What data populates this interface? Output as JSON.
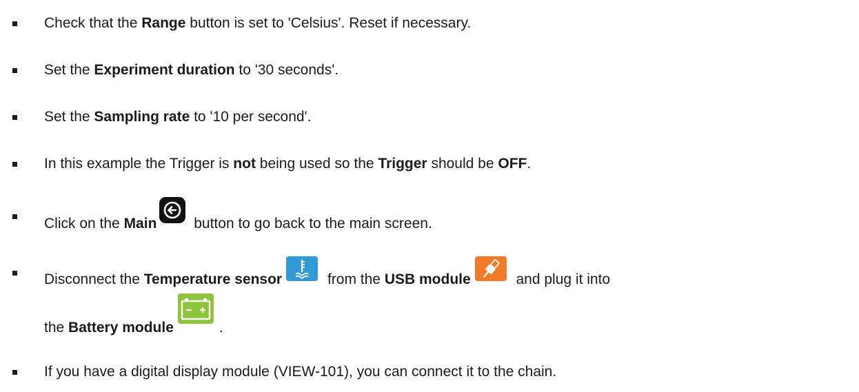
{
  "items": [
    {
      "parts": [
        "Check that the ",
        "Range",
        " button is set to 'Celsius'. Reset if necessary."
      ]
    },
    {
      "parts": [
        "Set the ",
        "Experiment duration",
        " to '30 seconds'."
      ]
    },
    {
      "parts": [
        "Set the ",
        "Sampling rate",
        " to '10 per second'."
      ]
    },
    {
      "parts": [
        "In this example the Trigger is ",
        "not",
        " being used so the ",
        "Trigger",
        " should be ",
        "OFF",
        "."
      ]
    },
    {
      "parts": [
        "Click on the ",
        "Main",
        " button to go back to the main screen."
      ]
    },
    {
      "parts": [
        "Disconnect the ",
        "Temperature sensor",
        " from the ",
        "USB module",
        " and plug it into"
      ],
      "continuation": [
        "the ",
        "Battery module",
        "."
      ]
    },
    {
      "parts": [
        "If you have a digital display module (VIEW-101), you can connect it to the chain."
      ]
    }
  ],
  "icons": {
    "main": "back-arrow-icon",
    "temperature": "temperature-sensor-icon",
    "usb": "usb-module-icon",
    "battery": "battery-module-icon"
  },
  "colors": {
    "temperature": "#2f9ad6",
    "usb": "#f27a29",
    "battery": "#8cc43a",
    "main": "#111111"
  }
}
